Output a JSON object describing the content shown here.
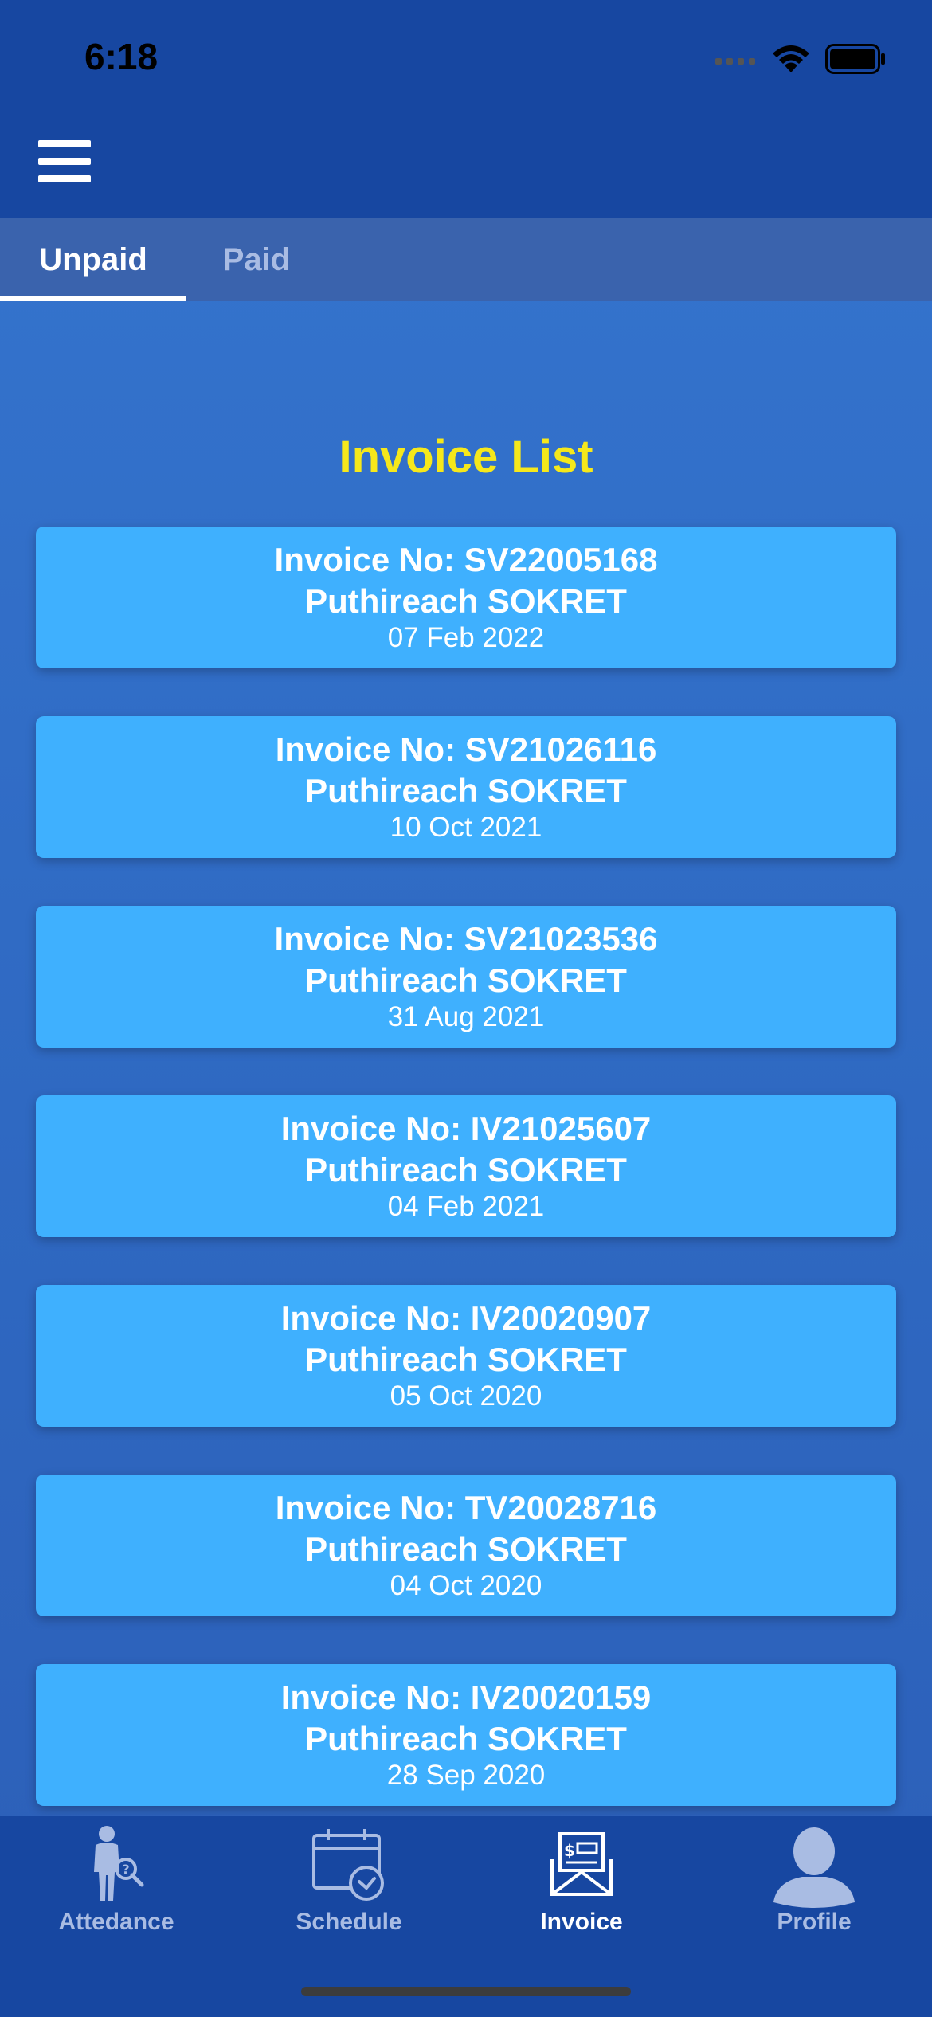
{
  "status": {
    "time": "6:18"
  },
  "tabs": [
    {
      "label": "Unpaid",
      "active": true
    },
    {
      "label": "Paid",
      "active": false
    }
  ],
  "title": "Invoice List",
  "invoices": [
    {
      "number": "Invoice No: SV22005168",
      "name": "Puthireach SOKRET",
      "date": "07 Feb 2022"
    },
    {
      "number": "Invoice No: SV21026116",
      "name": "Puthireach SOKRET",
      "date": "10 Oct 2021"
    },
    {
      "number": "Invoice No: SV21023536",
      "name": "Puthireach SOKRET",
      "date": "31 Aug 2021"
    },
    {
      "number": "Invoice No: IV21025607",
      "name": "Puthireach SOKRET",
      "date": "04 Feb 2021"
    },
    {
      "number": "Invoice No: IV20020907",
      "name": "Puthireach SOKRET",
      "date": "05 Oct 2020"
    },
    {
      "number": "Invoice No: TV20028716",
      "name": "Puthireach SOKRET",
      "date": "04 Oct 2020"
    },
    {
      "number": "Invoice No: IV20020159",
      "name": "Puthireach SOKRET",
      "date": "28 Sep 2020"
    }
  ],
  "bottom_nav": [
    {
      "label": "Attedance",
      "icon": "attendance-icon",
      "active": false
    },
    {
      "label": "Schedule",
      "icon": "calendar-clock-icon",
      "active": false
    },
    {
      "label": "Invoice",
      "icon": "invoice-icon",
      "active": true
    },
    {
      "label": "Profile",
      "icon": "profile-icon",
      "active": false
    }
  ],
  "colors": {
    "header": "#1747a1",
    "title": "#f6e81b",
    "card": "#3fb0fe",
    "inactive_text": "#a9bce3"
  }
}
